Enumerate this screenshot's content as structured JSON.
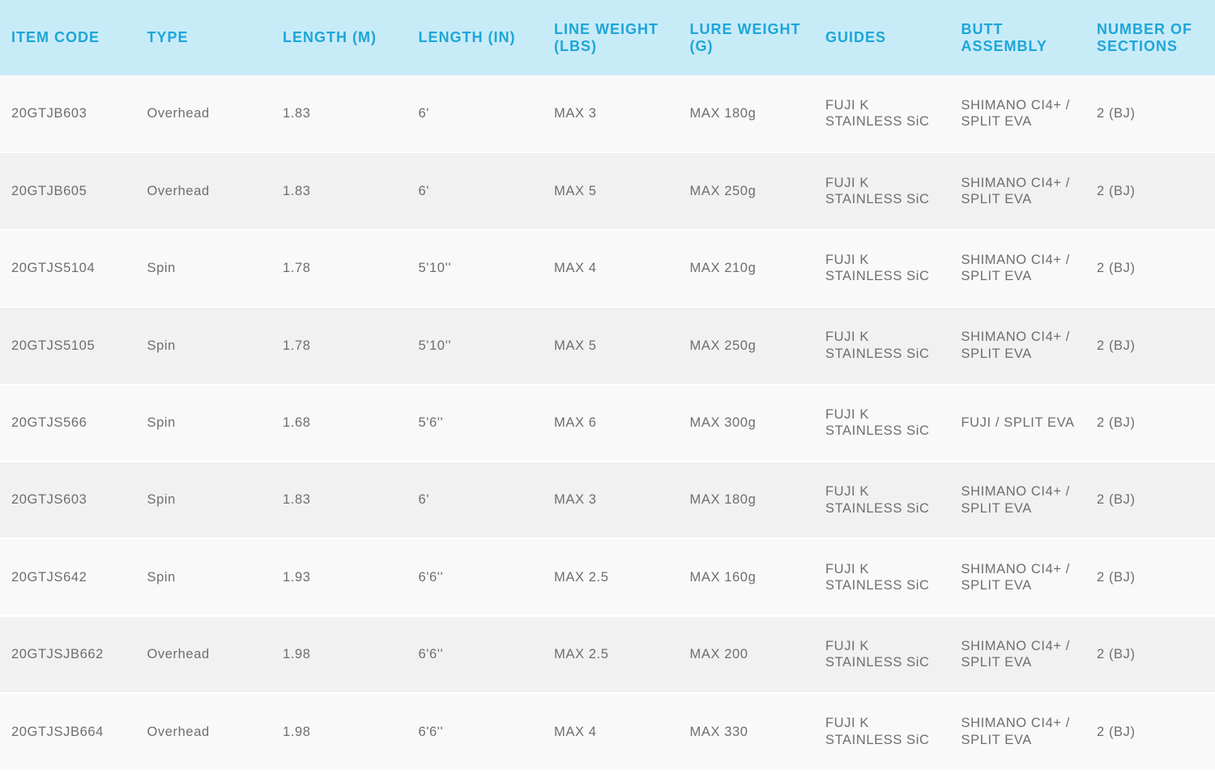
{
  "table": {
    "columns": [
      "ITEM CODE",
      "TYPE",
      "LENGTH (M)",
      "LENGTH (IN)",
      "LINE WEIGHT\n(LBS)",
      "LURE WEIGHT\n(G)",
      "GUIDES",
      "BUTT\nASSEMBLY",
      "NUMBER OF\nSECTIONS"
    ],
    "rows": [
      [
        "20GTJB603",
        "Overhead",
        "1.83",
        "6'",
        "MAX 3",
        "MAX 180g",
        "FUJI K\nSTAINLESS SiC",
        "SHIMANO CI4+ /\nSPLIT EVA",
        "2 (BJ)"
      ],
      [
        "20GTJB605",
        "Overhead",
        "1.83",
        "6'",
        "MAX 5",
        "MAX 250g",
        "FUJI K\nSTAINLESS SiC",
        "SHIMANO CI4+ /\nSPLIT EVA",
        "2 (BJ)"
      ],
      [
        "20GTJS5104",
        "Spin",
        "1.78",
        "5'10''",
        "MAX 4",
        "MAX 210g",
        "FUJI K\nSTAINLESS SiC",
        "SHIMANO CI4+ /\nSPLIT EVA",
        "2 (BJ)"
      ],
      [
        "20GTJS5105",
        "Spin",
        "1.78",
        "5'10''",
        "MAX 5",
        "MAX 250g",
        "FUJI K\nSTAINLESS SiC",
        "SHIMANO CI4+ /\nSPLIT EVA",
        "2 (BJ)"
      ],
      [
        "20GTJS566",
        "Spin",
        "1.68",
        "5'6''",
        "MAX 6",
        "MAX 300g",
        "FUJI K\nSTAINLESS SiC",
        "FUJI / SPLIT EVA",
        "2 (BJ)"
      ],
      [
        "20GTJS603",
        "Spin",
        "1.83",
        "6'",
        "MAX 3",
        "MAX 180g",
        "FUJI K\nSTAINLESS SiC",
        "SHIMANO CI4+ /\nSPLIT EVA",
        "2 (BJ)"
      ],
      [
        "20GTJS642",
        "Spin",
        "1.93",
        "6'6''",
        "MAX 2.5",
        "MAX 160g",
        "FUJI K\nSTAINLESS SiC",
        "SHIMANO CI4+ /\nSPLIT EVA",
        "2 (BJ)"
      ],
      [
        "20GTJSJB662",
        "Overhead",
        "1.98",
        "6'6''",
        "MAX 2.5",
        "MAX 200",
        "FUJI K\nSTAINLESS SiC",
        "SHIMANO CI4+ /\nSPLIT EVA",
        "2 (BJ)"
      ],
      [
        "20GTJSJB664",
        "Overhead",
        "1.98",
        "6'6''",
        "MAX 4",
        "MAX 330",
        "FUJI K\nSTAINLESS SiC",
        "SHIMANO CI4+ /\nSPLIT EVA",
        "2 (BJ)"
      ]
    ]
  },
  "colors": {
    "header_background": "#c8ebf8",
    "header_text": "#1da6d8",
    "row_light": "#f9f9f9",
    "row_dark": "#f1f1f1",
    "cell_text": "#6e6e6e"
  }
}
